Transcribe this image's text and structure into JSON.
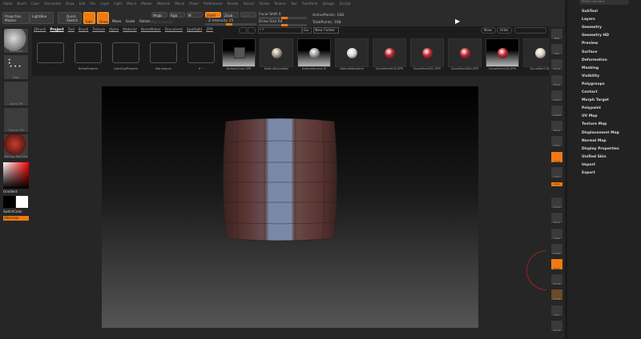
{
  "menu": [
    "Alpha",
    "Brush",
    "Color",
    "Document",
    "Draw",
    "Edit",
    "File",
    "Layer",
    "Light",
    "Macro",
    "Marker",
    "Material",
    "Movie",
    "Picker",
    "Preferences",
    "Render",
    "Stencil",
    "Stroke",
    "Texture",
    "Tool",
    "Transform",
    "Zplugin",
    "Zscript"
  ],
  "toolbar": {
    "projection_master": "Projection Master",
    "lightbox": "LightBox",
    "quick_sketch": "Quick Sketch",
    "edit": "Edit",
    "draw": "Draw",
    "move": "Move",
    "scale": "Scale",
    "rotate": "Rotate",
    "mrgb": "Mrgb",
    "rgb": "Rgb",
    "m": "M",
    "rgb_intensity": "Rgb Intensity",
    "zadd": "Zadd",
    "zsub": "Zsub",
    "zcut": "Zcut",
    "z_intensity": "Z Intensity 25",
    "focal_shift": "Focal Shift 0",
    "draw_size": "Draw Size 64",
    "active_points": "ActivePoints: 168",
    "total_points": "TotalPoints: 168"
  },
  "left": {
    "brush": "Standard",
    "stroke": "Dots",
    "alpha": "Alpha Off",
    "texture": "Texture Off",
    "material": "MatCap Red Wax",
    "gradient": "Gradient",
    "switch_color": "SwitchColor",
    "alternate": "Alternate"
  },
  "lightbox": {
    "tabs": [
      "ZBrush",
      "Project",
      "Tool",
      "Brush",
      "Texture",
      "Alpha",
      "Material",
      "NoiseMaker",
      "Document",
      "Spotlight",
      "ZPR"
    ],
    "active_tab": "Project",
    "search": "*.*",
    "go": "Go",
    "new_folder": "New Folder",
    "new": "New",
    "hide": "Hide",
    "items": [
      {
        "label": "..",
        "type": "folder"
      },
      {
        "label": "DemoProjects",
        "type": "folder"
      },
      {
        "label": "LightCapProjects",
        "type": "folder"
      },
      {
        "label": "Mannequin",
        "type": "folder"
      },
      {
        "label": "if ~",
        "type": "folder"
      },
      {
        "label": "DefaultCube.ZPR",
        "type": "cube"
      },
      {
        "label": "DefaultDynaWax",
        "color": "#a89a88"
      },
      {
        "label": "DefaultSphere.ZI",
        "color": "#9a9a9a"
      },
      {
        "label": "DefaultWaxSphe",
        "color": "#d8d8d8"
      },
      {
        "label": "DynaMesh016.ZPR",
        "color": "#c02030"
      },
      {
        "label": "DynaMesh032.ZPR",
        "color": "#c02030"
      },
      {
        "label": "DynaMesh064.ZPR",
        "color": "#c02030"
      },
      {
        "label": "DynaMesh128.ZPR",
        "color": "#c02030"
      },
      {
        "label": "DynaWax128.",
        "color": "#d8d0c0"
      }
    ]
  },
  "right_shelf": [
    "BPR",
    "SPix",
    "Scroll",
    "Zoom",
    "Actual",
    "AAHalf",
    "Persp",
    "Floor",
    "Local",
    "L.Sym",
    "Qxyz",
    "Frame",
    "Move",
    "Scale",
    "Rotate",
    "PolyF",
    "Transp",
    "Ghost",
    "Solo",
    "Xpose"
  ],
  "panel": {
    "tool_name": "PM3D_Cylinder3",
    "items": [
      "SubTool",
      "Layers",
      "Geometry",
      "Geometry HD",
      "Preview",
      "Surface",
      "Deformation",
      "Masking",
      "Visibility",
      "Polygroups",
      "Contact",
      "Morph Target",
      "Polypaint",
      "UV Map",
      "Texture Map",
      "Displacement Map",
      "Normal Map",
      "Display Properties",
      "Unified Skin",
      "Import",
      "Export"
    ]
  },
  "colors": {
    "accent": "#f07a10",
    "mesh": "#5a3532",
    "mesh_highlight": "#7a88a8"
  }
}
